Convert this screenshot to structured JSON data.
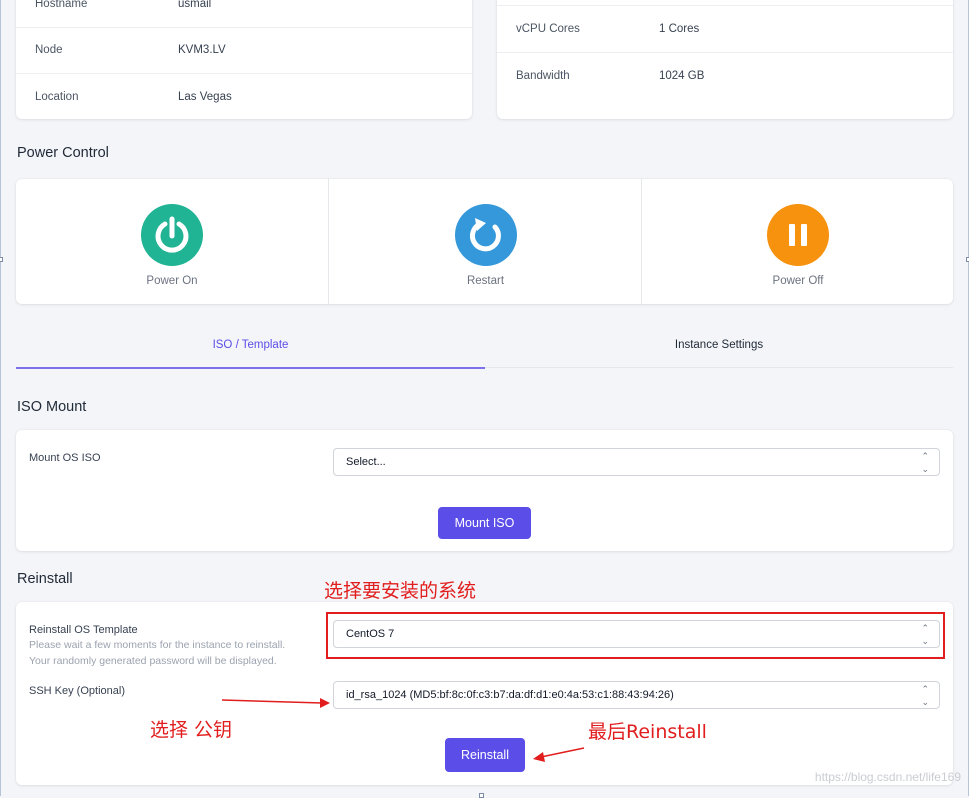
{
  "server_info_left": [
    {
      "key": "Hostname",
      "value": "usmail"
    },
    {
      "key": "Node",
      "value": "KVM3.LV"
    },
    {
      "key": "Location",
      "value": "Las Vegas"
    }
  ],
  "server_info_right": [
    {
      "key": "vCPU Cores",
      "value": "1 Cores"
    },
    {
      "key": "Bandwidth",
      "value": "1024 GB"
    }
  ],
  "power": {
    "title": "Power Control",
    "on": {
      "label": "Power On",
      "color": "#20b394"
    },
    "restart": {
      "label": "Restart",
      "color": "#3498db"
    },
    "off": {
      "label": "Power Off",
      "color": "#f7920e"
    }
  },
  "tabs": [
    {
      "label": "ISO / Template",
      "active": true
    },
    {
      "label": "Instance Settings",
      "active": false
    }
  ],
  "iso": {
    "title": "ISO Mount",
    "field_label": "Mount OS ISO",
    "select_value": "Select...",
    "button": "Mount ISO"
  },
  "reinstall": {
    "title": "Reinstall",
    "template_label": "Reinstall OS Template",
    "hint_1": "Please wait a few moments for the instance to reinstall.",
    "hint_2": "Your randomly generated password will be displayed.",
    "template_value": "CentOS 7",
    "ssh_label": "SSH Key (Optional)",
    "ssh_value": "id_rsa_1024 (MD5:bf:8c:0f:c3:b7:da:df:d1:e0:4a:53:c1:88:43:94:26)",
    "button": "Reinstall"
  },
  "annotations": {
    "choose_system": "选择要安装的系统",
    "choose_key": "选择 公钥",
    "finally_reinstall": "最后Reinstall"
  },
  "watermark": "https://blog.csdn.net/life169",
  "colors": {
    "accent": "#5b4de8",
    "annotation": "#e11d1d"
  }
}
